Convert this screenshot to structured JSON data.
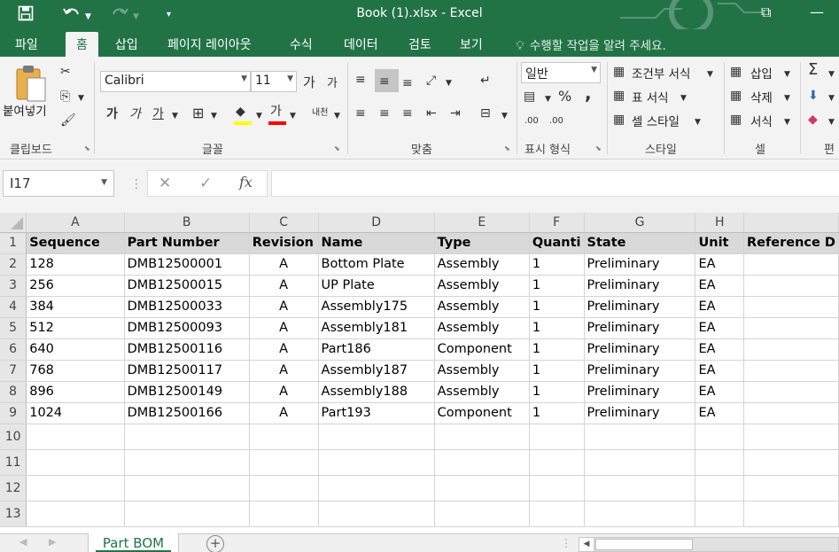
{
  "window": {
    "title": "Book (1).xlsx - Excel"
  },
  "quick_access": {
    "save_icon": "save-icon",
    "undo_icon": "undo-icon",
    "redo_icon": "redo-icon",
    "customize_icon": "customize-icon"
  },
  "tabs": [
    {
      "label": "파일"
    },
    {
      "label": "홈"
    },
    {
      "label": "삽입"
    },
    {
      "label": "페이지 레이아웃"
    },
    {
      "label": "수식"
    },
    {
      "label": "데이터"
    },
    {
      "label": "검토"
    },
    {
      "label": "보기"
    }
  ],
  "tell_me": "수행할 작업을 알려 주세요.",
  "ribbon": {
    "clipboard": {
      "paste_label": "붙여넣기",
      "group_label": "클립보드"
    },
    "font": {
      "font_name": "Calibri",
      "font_size": "11",
      "grow": "가",
      "shrink": "가",
      "bold": "가",
      "italic": "가",
      "underline": "가",
      "font_color": "가",
      "phonetic": "내천",
      "fill_color_hex": "#ffff00",
      "font_color_hex": "#ff0000",
      "group_label": "글꼴"
    },
    "alignment": {
      "group_label": "맞춤"
    },
    "number": {
      "format": "일반",
      "percent": "%",
      "comma": ",",
      "inc_decimal": ".00",
      "dec_decimal": ".00",
      "group_label": "표시 형식"
    },
    "styles": {
      "conditional": "조건부 서식",
      "table_format": "표 서식",
      "cell_style": "셀 스타일",
      "group_label": "스타일"
    },
    "cells": {
      "insert": "삽입",
      "delete": "삭제",
      "format": "서식",
      "group_label": "셀"
    },
    "editing": {
      "group_label": "편"
    }
  },
  "formula_bar": {
    "name_box": "I17",
    "cancel": "✕",
    "enter": "✓",
    "fx": "fx",
    "value": ""
  },
  "columns": [
    "A",
    "B",
    "C",
    "D",
    "E",
    "F",
    "G",
    "H",
    ""
  ],
  "headers": [
    "Sequence",
    "Part Number",
    "Revision",
    "Name",
    "Type",
    "Quanti",
    "State",
    "Unit",
    "Reference D"
  ],
  "rows": [
    [
      "128",
      "DMB12500001",
      "A",
      "Bottom Plate",
      "Assembly",
      "1",
      "Preliminary",
      "EA",
      ""
    ],
    [
      "256",
      "DMB12500015",
      "A",
      "UP Plate",
      "Assembly",
      "1",
      "Preliminary",
      "EA",
      ""
    ],
    [
      "384",
      "DMB12500033",
      "A",
      "Assembly175",
      "Assembly",
      "1",
      "Preliminary",
      "EA",
      ""
    ],
    [
      "512",
      "DMB12500093",
      "A",
      "Assembly181",
      "Assembly",
      "1",
      "Preliminary",
      "EA",
      ""
    ],
    [
      "640",
      "DMB12500116",
      "A",
      "Part186",
      "Component",
      "1",
      "Preliminary",
      "EA",
      ""
    ],
    [
      "768",
      "DMB12500117",
      "A",
      "Assembly187",
      "Assembly",
      "1",
      "Preliminary",
      "EA",
      ""
    ],
    [
      "896",
      "DMB12500149",
      "A",
      "Assembly188",
      "Assembly",
      "1",
      "Preliminary",
      "EA",
      ""
    ],
    [
      "1024",
      "DMB12500166",
      "A",
      "Part193",
      "Component",
      "1",
      "Preliminary",
      "EA",
      ""
    ]
  ],
  "row_numbers": [
    "1",
    "2",
    "3",
    "4",
    "5",
    "6",
    "7",
    "8",
    "9",
    "10",
    "11",
    "12",
    "13"
  ],
  "sheet_tabs": [
    {
      "label": "Part BOM"
    }
  ],
  "colors": {
    "excel_green": "#217346",
    "header_gray": "#d9d9d9"
  }
}
